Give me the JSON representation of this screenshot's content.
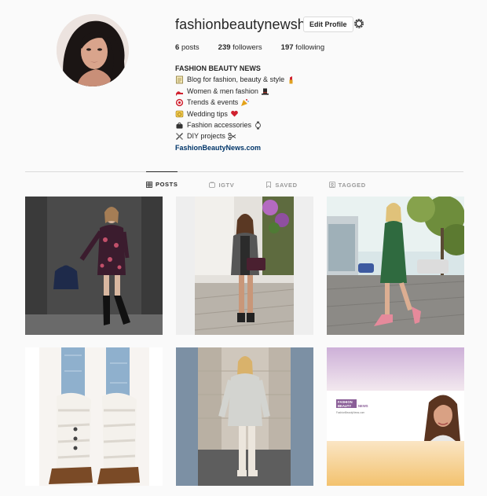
{
  "profile": {
    "username": "fashionbeautynewshq",
    "edit_label": "Edit Profile",
    "posts_count": "6",
    "posts_label": "posts",
    "followers_count": "239",
    "followers_label": "followers",
    "following_count": "197",
    "following_label": "following"
  },
  "bio": {
    "name": "FASHION BEAUTY NEWS",
    "lines": [
      "Blog for fashion, beauty & style",
      "Women & men fashion",
      "Trends & events",
      "Wedding tips",
      "Fashion accessories",
      "DIY projects"
    ],
    "link": "FashionBeautyNews.com"
  },
  "tabs": [
    {
      "label": "POSTS",
      "icon": "grid-icon",
      "active": true
    },
    {
      "label": "IGTV",
      "icon": "igtv-icon",
      "active": false
    },
    {
      "label": "SAVED",
      "icon": "bookmark-icon",
      "active": false
    },
    {
      "label": "TAGGED",
      "icon": "tag-icon",
      "active": false
    }
  ],
  "posts": [
    {
      "description": "model in floral dress with navy bag"
    },
    {
      "description": "woman in grey blazer on street"
    },
    {
      "description": "woman in green dress on sidewalk"
    },
    {
      "description": "knit leg warmers with boots"
    },
    {
      "description": "woman in grey sweater and white boots"
    },
    {
      "description": "fashion beauty news banner"
    }
  ],
  "banner": {
    "logo_line1": "FASHION",
    "logo_line2": "BEAUTY",
    "logo_line3": "NEWS",
    "url": "FashionBeautyNews.com"
  },
  "colors": {
    "link": "#003569",
    "border": "#dbdbdb",
    "muted": "#999999",
    "logo_purple": "#8a5e97"
  }
}
